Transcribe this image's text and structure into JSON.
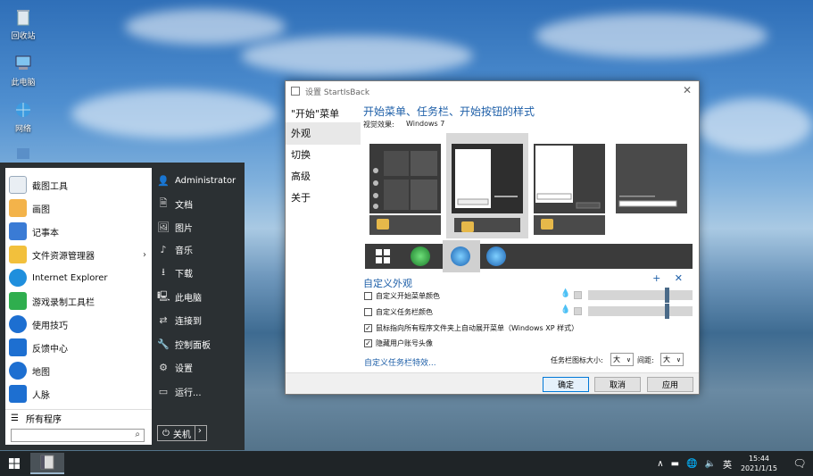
{
  "desktop": {
    "icons": [
      {
        "label": "回收站",
        "icon": "recycle-bin-icon"
      },
      {
        "label": "此电脑",
        "icon": "computer-icon"
      },
      {
        "label": "网络",
        "icon": "network-icon"
      }
    ]
  },
  "start_menu": {
    "items": [
      {
        "label": "截图工具",
        "color": "#e9eef3"
      },
      {
        "label": "画图",
        "color": "#f3b34a"
      },
      {
        "label": "记事本",
        "color": "#3a7bd5"
      },
      {
        "label": "文件资源管理器",
        "color": "#f2c03c"
      },
      {
        "label": "Internet Explorer",
        "color": "#1f8fdd"
      },
      {
        "label": "游戏录制工具栏",
        "color": "#2fae4e"
      },
      {
        "label": "使用技巧",
        "color": "#1d6fd1"
      },
      {
        "label": "反馈中心",
        "color": "#1d6fd1"
      },
      {
        "label": "地图",
        "color": "#1d6fd1"
      },
      {
        "label": "人脉",
        "color": "#1d6fd1"
      }
    ],
    "submenu_arrow": "›",
    "all_programs": "所有程序",
    "search_icon": "⌕",
    "right": [
      {
        "label": "Administrator",
        "icon": "👤"
      },
      {
        "label": "文档",
        "icon": "🗎"
      },
      {
        "label": "图片",
        "icon": "🖼"
      },
      {
        "label": "音乐",
        "icon": "♪"
      },
      {
        "label": "下载",
        "icon": "⭳"
      },
      {
        "label": "此电脑",
        "icon": "🖳"
      },
      {
        "label": "连接到",
        "icon": "⇄"
      },
      {
        "label": "控制面板",
        "icon": "🔧"
      },
      {
        "label": "设置",
        "icon": "⚙"
      },
      {
        "label": "运行...",
        "icon": "▭"
      }
    ],
    "shutdown": {
      "icon": "⏻",
      "label": "关机",
      "arrow": "›"
    }
  },
  "taskbar": {
    "tray": {
      "chevron": "∧",
      "battery": "▬",
      "network": "🌐",
      "volume": "🔈",
      "ime": "英"
    },
    "time": "15:44",
    "date": "2021/1/15",
    "notify_icon": "🗨"
  },
  "window": {
    "title": "设置 StartIsBack",
    "close": "✕",
    "nav": [
      "\"开始\"菜单",
      "外观",
      "切换",
      "高级",
      "关于"
    ],
    "active_nav": 1,
    "heading": "开始菜单、任务栏、开始按钮的样式",
    "visual_label": "视觉效果:",
    "visual_value": "Windows 7",
    "custom_title": "自定义外观",
    "add_remove": "+ ✕",
    "checks": [
      {
        "label": "自定义开始菜单颜色",
        "checked": false
      },
      {
        "label": "自定义任务栏颜色",
        "checked": false
      },
      {
        "label": "鼠标指向所有程序文件夹上自动展开菜单（Windows XP 样式）",
        "checked": true
      },
      {
        "label": "隐藏用户账号头像",
        "checked": true
      }
    ],
    "check_mark": "✓",
    "drop_icon": "💧",
    "taskbar_fx": "自定义任务栏特效...",
    "icon_size_label": "任务栏图标大小:",
    "icon_size": "大",
    "spacing_label": "间距:",
    "spacing": "大",
    "dropdown_arrow": "∨",
    "buttons": {
      "ok": "确定",
      "cancel": "取消",
      "apply": "应用"
    }
  },
  "colors": {
    "accent": "#1e5fa8",
    "startmenu_bg": "#2b3033",
    "taskbar_bg": "#1f2427"
  }
}
